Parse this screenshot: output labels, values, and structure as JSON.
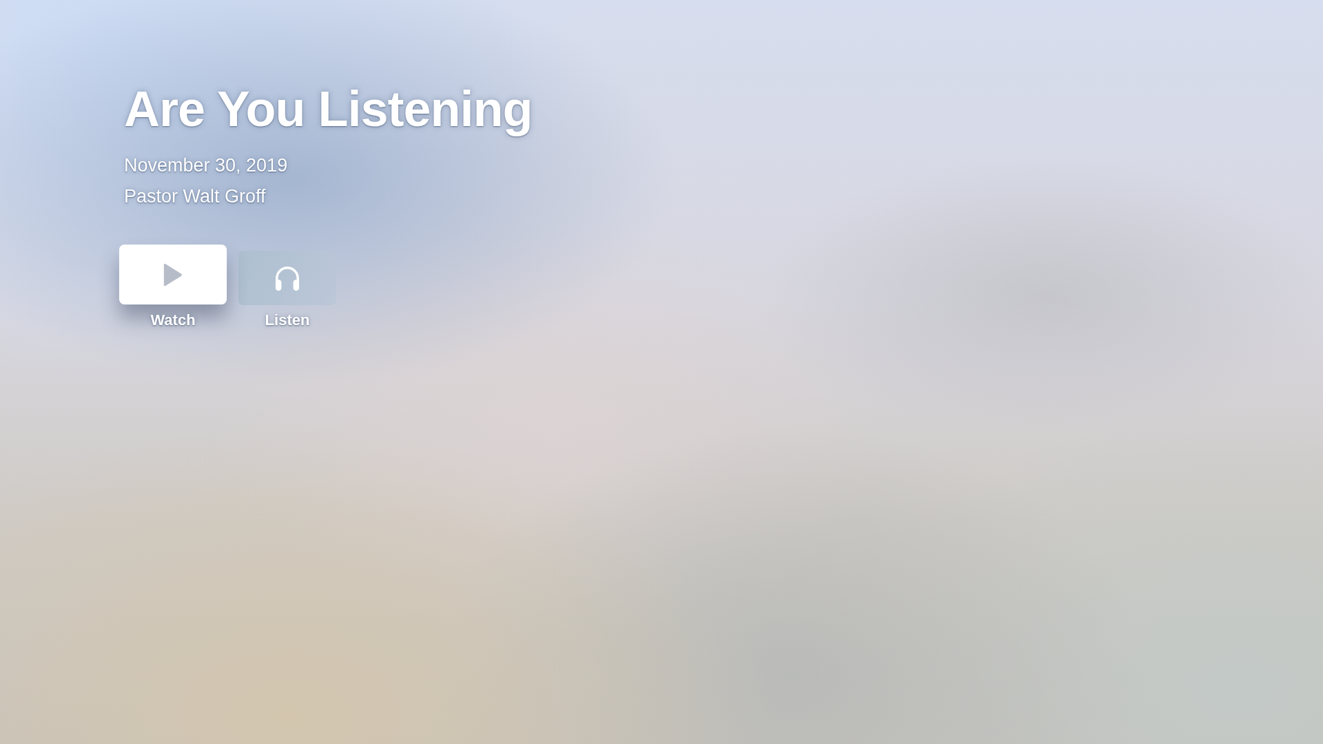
{
  "title": "Are You Listening",
  "date": "November 30, 2019",
  "speaker": "Pastor Walt Groff",
  "actions": [
    {
      "kind": "video",
      "label": "Watch",
      "selected": true
    },
    {
      "kind": "audio",
      "label": "Listen",
      "selected": false
    }
  ]
}
